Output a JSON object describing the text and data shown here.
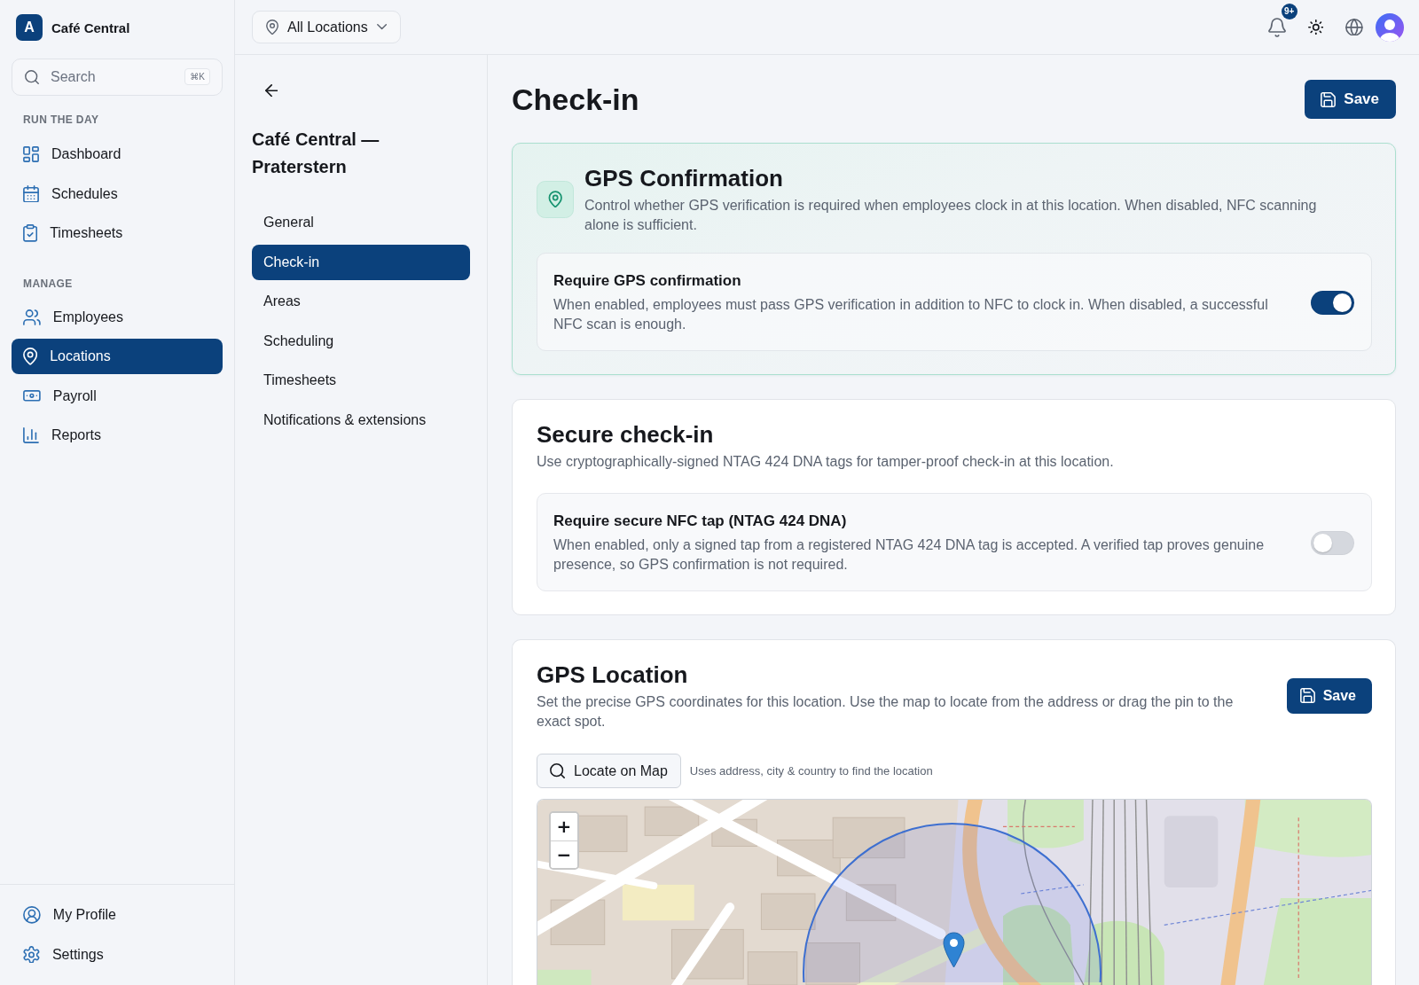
{
  "sidebar": {
    "brand": {
      "initial": "A",
      "name": "Café Central"
    },
    "search": {
      "placeholder": "Search",
      "shortcut": "⌘K"
    },
    "sections": [
      {
        "heading": "RUN THE DAY",
        "items": [
          {
            "label": "Dashboard",
            "selected": false
          },
          {
            "label": "Schedules",
            "selected": false
          },
          {
            "label": "Timesheets",
            "selected": false
          }
        ]
      },
      {
        "heading": "MANAGE",
        "items": [
          {
            "label": "Employees",
            "selected": false
          },
          {
            "label": "Locations",
            "selected": true
          },
          {
            "label": "Payroll",
            "selected": false
          },
          {
            "label": "Reports",
            "selected": false
          }
        ]
      }
    ],
    "footer_items": [
      {
        "label": "My Profile",
        "selected": false
      },
      {
        "label": "Settings",
        "selected": false
      }
    ]
  },
  "topbar": {
    "location_filter": "All Locations",
    "notification_badge": "9+"
  },
  "location_nav": {
    "title": "Café Central — Praterstern",
    "items": [
      {
        "label": "General",
        "selected": false
      },
      {
        "label": "Check-in",
        "selected": true
      },
      {
        "label": "Areas",
        "selected": false
      },
      {
        "label": "Scheduling",
        "selected": false
      },
      {
        "label": "Timesheets",
        "selected": false
      },
      {
        "label": "Notifications & extensions",
        "selected": false
      }
    ]
  },
  "page": {
    "title": "Check-in",
    "save_button": "Save"
  },
  "cards": [
    {
      "kind": "feature",
      "title": "GPS Confirmation",
      "description": "Control whether GPS verification is required when employees clock in at this location. When disabled, NFC scanning alone is sufficient.",
      "setting": {
        "title": "Require GPS confirmation",
        "description": "When enabled, employees must pass GPS verification in addition to NFC to clock in. When disabled, a successful NFC scan is enough.",
        "on": true
      }
    },
    {
      "kind": "setting",
      "title": "Secure check-in",
      "description": "Use cryptographically-signed NTAG 424 DNA tags for tamper-proof check-in at this location.",
      "setting": {
        "title": "Require secure NFC tap (NTAG 424 DNA)",
        "description": "When enabled, only a signed tap from a registered NTAG 424 DNA tag is accepted. A verified tap proves genuine presence, so GPS confirmation is not required.",
        "on": false
      }
    },
    {
      "kind": "map",
      "title": "GPS Location",
      "description": "Set the precise GPS coordinates for this location. Use the map to locate from the address or drag the pin to the exact spot.",
      "save_button": "Save",
      "locate_button": "Locate on Map",
      "hint": "Uses address, city & country to find the location",
      "map": {
        "zoom_in": "+",
        "zoom_out": "−"
      }
    }
  ]
}
